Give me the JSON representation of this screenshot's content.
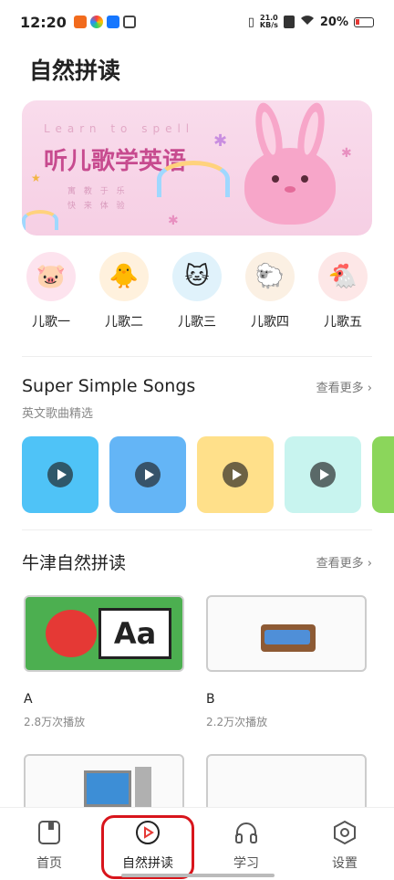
{
  "status_bar": {
    "time": "12:20",
    "network_speed": "21.0",
    "network_unit": "KB/s",
    "battery": "20%"
  },
  "page": {
    "title": "自然拼读"
  },
  "banner": {
    "subtitle_en": "Learn to spell",
    "title": "听儿歌学英语",
    "tagline1": "寓 教 于 乐",
    "tagline2": "快 来 体 验"
  },
  "songs": [
    {
      "label": "儿歌一",
      "icon": "pig-icon"
    },
    {
      "label": "儿歌二",
      "icon": "chick-icon"
    },
    {
      "label": "儿歌三",
      "icon": "cat-icon"
    },
    {
      "label": "儿歌四",
      "icon": "sheep-icon"
    },
    {
      "label": "儿歌五",
      "icon": "chicken-icon"
    }
  ],
  "section_songs": {
    "title": "Super Simple Songs",
    "subtitle": "英文歌曲精选",
    "more": "查看更多 ›"
  },
  "section_oxford": {
    "title": "牛津自然拼读",
    "more": "查看更多 ›"
  },
  "courses": [
    {
      "name": "A",
      "plays": "2.8万次播放",
      "thumb_text": "Aa"
    },
    {
      "name": "B",
      "plays": "2.2万次播放"
    }
  ],
  "tabs": [
    {
      "label": "首页"
    },
    {
      "label": "自然拼读"
    },
    {
      "label": "学习"
    },
    {
      "label": "设置"
    }
  ],
  "colors": {
    "accent_red": "#d8151c",
    "banner_pink": "#f9dcec",
    "title_pink": "#c74b8f"
  }
}
